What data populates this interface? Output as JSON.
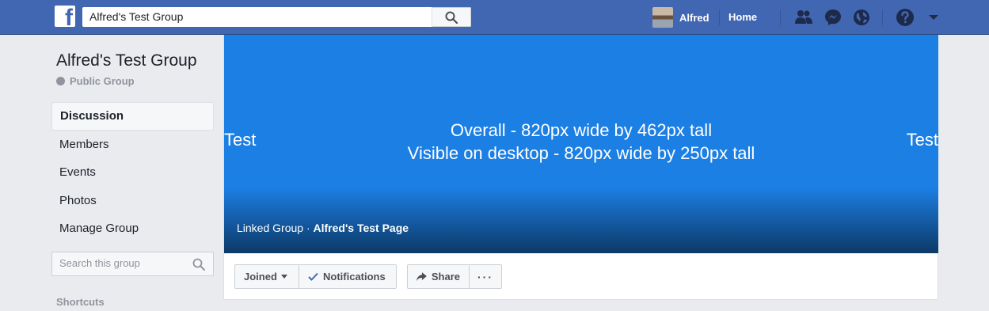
{
  "topbar": {
    "logo": "f",
    "search_value": "Alfred's Test Group",
    "search_icon": "search-icon",
    "profile_name": "Alfred",
    "home_label": "Home",
    "icons": [
      "friend-requests-icon",
      "messenger-icon",
      "notifications-globe-icon",
      "help-icon",
      "account-menu-chevron-icon"
    ]
  },
  "group": {
    "title": "Alfred's Test Group",
    "privacy": "Public Group"
  },
  "leftnav": {
    "items": [
      {
        "label": "Discussion",
        "active": true
      },
      {
        "label": "Members"
      },
      {
        "label": "Events"
      },
      {
        "label": "Photos"
      },
      {
        "label": "Manage Group"
      }
    ],
    "search_placeholder": "Search this group",
    "shortcuts_label": "Shortcuts"
  },
  "cover": {
    "line1": "Overall - 820px wide by 462px tall",
    "line2": "Visible on desktop - 820px wide by 250px tall",
    "side_left": "Test",
    "side_right": "Test",
    "linked_prefix": "Linked Group · ",
    "linked_page": "Alfred's Test Page",
    "background_color": "#1c7fe4"
  },
  "actions": {
    "joined_label": "Joined",
    "notifications_label": "Notifications",
    "share_label": "Share",
    "more_label": "···"
  },
  "colors": {
    "topbar": "#4267b2",
    "page_bg": "#e9ebee"
  }
}
